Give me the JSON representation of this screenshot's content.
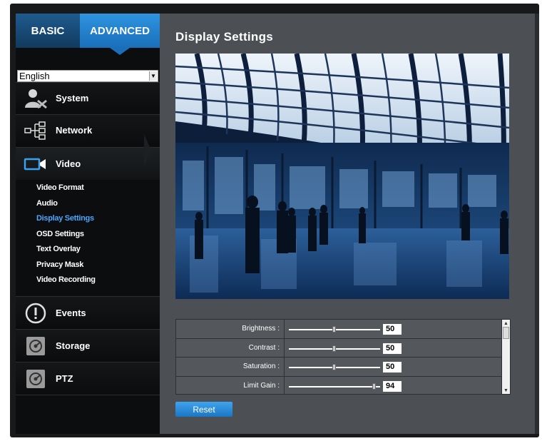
{
  "tabs": {
    "basic": "BASIC",
    "advanced": "ADVANCED"
  },
  "language": {
    "selected": "English"
  },
  "sidebar": {
    "items": [
      {
        "label": "System",
        "icon": "system-user-icon"
      },
      {
        "label": "Network",
        "icon": "network-icon"
      },
      {
        "label": "Video",
        "icon": "video-camera-icon"
      },
      {
        "label": "Events",
        "icon": "events-alert-icon"
      },
      {
        "label": "Storage",
        "icon": "storage-disk-icon"
      },
      {
        "label": "PTZ",
        "icon": "ptz-icon"
      }
    ],
    "video_submenu": [
      "Video Format",
      "Audio",
      "Display Settings",
      "OSD Settings",
      "Text Overlay",
      "Privacy Mask",
      "Video Recording"
    ],
    "active_submenu": "Display Settings"
  },
  "page": {
    "title": "Display Settings"
  },
  "settings": [
    {
      "label": "Brightness :",
      "value": "50",
      "fraction": 0.5
    },
    {
      "label": "Contrast :",
      "value": "50",
      "fraction": 0.5
    },
    {
      "label": "Saturation :",
      "value": "50",
      "fraction": 0.5
    },
    {
      "label": "Limit Gain :",
      "value": "94",
      "fraction": 0.94
    }
  ],
  "buttons": {
    "reset": "Reset"
  },
  "colors": {
    "accent": "#1a6fba",
    "active_link": "#4aa8ff",
    "panel": "#4c5054"
  }
}
